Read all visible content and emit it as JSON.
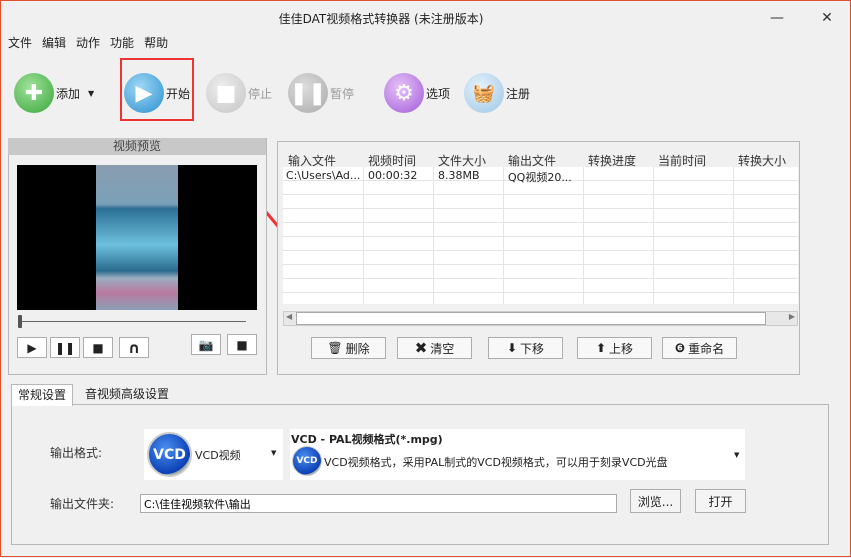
{
  "window": {
    "title": "佳佳DAT视频格式转换器  (未注册版本)",
    "minimize": "—",
    "close": "✕"
  },
  "menu": [
    "文件",
    "编辑",
    "动作",
    "功能",
    "帮助"
  ],
  "toolbar": {
    "add": "添加",
    "start": "开始",
    "stop": "停止",
    "pause": "暂停",
    "options": "选项",
    "register": "注册"
  },
  "preview": {
    "title": "视频预览",
    "progress": 0
  },
  "table": {
    "columns": [
      "输入文件",
      "视频时间",
      "文件大小",
      "输出文件",
      "转换进度",
      "当前时间",
      "转换大小"
    ],
    "rows": [
      [
        "C:\\Users\\Ad...",
        "00:00:32",
        "8.38MB",
        "QQ视频20...",
        "",
        "",
        ""
      ]
    ]
  },
  "actions": {
    "delete": "删除",
    "clear": "清空",
    "down": "下移",
    "up": "上移",
    "rename": "重命名"
  },
  "tabs": [
    "常规设置",
    "音视频高级设置"
  ],
  "settings": {
    "format_label": "输出格式:",
    "format_icon": "VCD",
    "format_value": "VCD视频",
    "preset_title": "VCD - PAL视频格式(*.mpg)",
    "preset_desc": "VCD视频格式，采用PAL制式的VCD视频格式，可以用于刻录VCD光盘",
    "folder_label": "输出文件夹:",
    "folder_value": "C:\\佳佳视频软件\\输出",
    "browse": "浏览...",
    "open": "打开"
  }
}
